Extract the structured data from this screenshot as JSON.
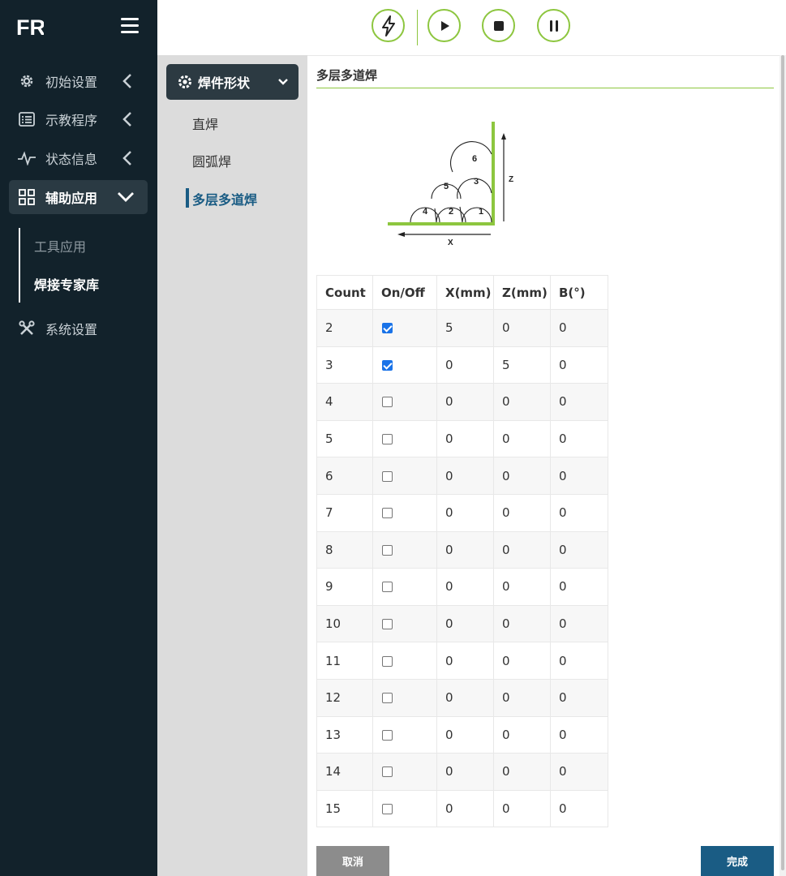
{
  "app": {
    "logo_text": "FR"
  },
  "sidebar": {
    "items": [
      {
        "label": "初始设置",
        "icon": "gear-icon"
      },
      {
        "label": "示教程序",
        "icon": "list-icon"
      },
      {
        "label": "状态信息",
        "icon": "pulse-icon"
      },
      {
        "label": "辅助应用",
        "icon": "grid-icon"
      },
      {
        "label": "系统设置",
        "icon": "tools-icon"
      }
    ],
    "subitems": [
      {
        "label": "工具应用"
      },
      {
        "label": "焊接专家库"
      }
    ]
  },
  "toolbar": {
    "buttons": [
      "lightning-icon",
      "play-icon",
      "stop-icon",
      "pause-icon"
    ],
    "accent": "#8dc63f"
  },
  "panel2": {
    "header": "焊件形状",
    "items": [
      {
        "label": "直焊"
      },
      {
        "label": "圆弧焊"
      },
      {
        "label": "多层多道焊"
      }
    ]
  },
  "main": {
    "title": "多层多道焊",
    "diagram": {
      "beads": [
        "1",
        "2",
        "3",
        "4",
        "5",
        "6"
      ],
      "x_label": "X",
      "z_label": "Z"
    },
    "table": {
      "headers": [
        "Count",
        "On/Off",
        "X(mm)",
        "Z(mm)",
        "B(°)"
      ],
      "rows": [
        {
          "count": "2",
          "on": true,
          "x": "5",
          "z": "0",
          "b": "0"
        },
        {
          "count": "3",
          "on": true,
          "x": "0",
          "z": "5",
          "b": "0"
        },
        {
          "count": "4",
          "on": false,
          "x": "0",
          "z": "0",
          "b": "0"
        },
        {
          "count": "5",
          "on": false,
          "x": "0",
          "z": "0",
          "b": "0"
        },
        {
          "count": "6",
          "on": false,
          "x": "0",
          "z": "0",
          "b": "0"
        },
        {
          "count": "7",
          "on": false,
          "x": "0",
          "z": "0",
          "b": "0"
        },
        {
          "count": "8",
          "on": false,
          "x": "0",
          "z": "0",
          "b": "0"
        },
        {
          "count": "9",
          "on": false,
          "x": "0",
          "z": "0",
          "b": "0"
        },
        {
          "count": "10",
          "on": false,
          "x": "0",
          "z": "0",
          "b": "0"
        },
        {
          "count": "11",
          "on": false,
          "x": "0",
          "z": "0",
          "b": "0"
        },
        {
          "count": "12",
          "on": false,
          "x": "0",
          "z": "0",
          "b": "0"
        },
        {
          "count": "13",
          "on": false,
          "x": "0",
          "z": "0",
          "b": "0"
        },
        {
          "count": "14",
          "on": false,
          "x": "0",
          "z": "0",
          "b": "0"
        },
        {
          "count": "15",
          "on": false,
          "x": "0",
          "z": "0",
          "b": "0"
        }
      ]
    },
    "cancel_label": "取消",
    "done_label": "完成"
  }
}
